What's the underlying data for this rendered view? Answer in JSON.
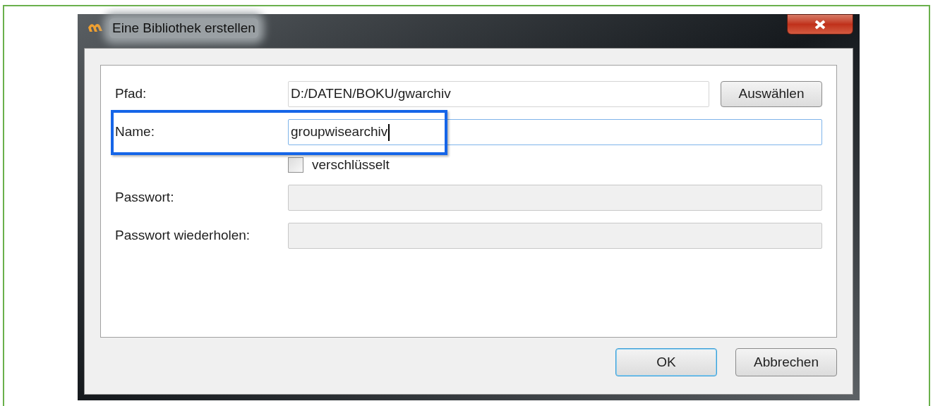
{
  "window": {
    "title": "Eine Bibliothek erstellen"
  },
  "fields": [
    {
      "kind": "text",
      "label": "Pfad:",
      "value": "D:/DATEN/BOKU/gwarchiv",
      "focused": false,
      "disabled": false,
      "highlighted": false,
      "button": "Auswählen"
    },
    {
      "kind": "text",
      "label": "Name:",
      "value": "groupwisearchiv",
      "focused": true,
      "disabled": false,
      "highlighted": true
    },
    {
      "kind": "checkbox",
      "label": "verschlüsselt",
      "checked": false
    },
    {
      "kind": "text",
      "label": "Passwort:",
      "focused": false,
      "disabled": true,
      "highlighted": false
    },
    {
      "kind": "text",
      "label": "Passwort wiederholen:",
      "focused": false,
      "disabled": true,
      "highlighted": false
    }
  ],
  "buttons": [
    {
      "label": "OK",
      "default": true
    },
    {
      "label": "Abbrechen",
      "default": false
    }
  ]
}
